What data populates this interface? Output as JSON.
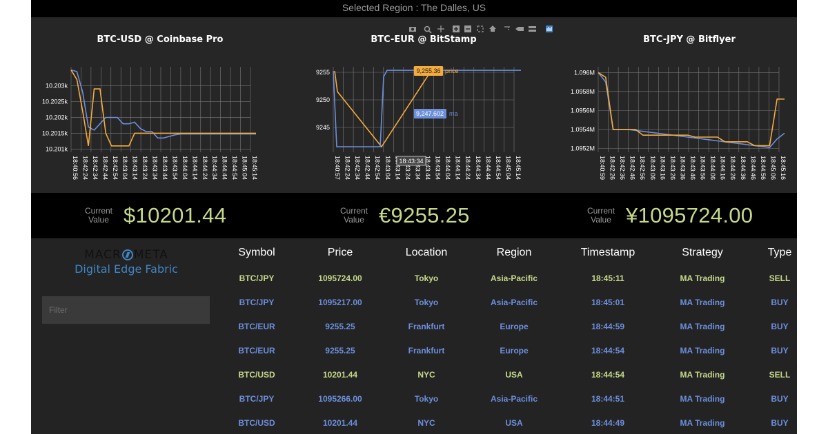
{
  "region_text": "Selected Region : The Dalles, US",
  "colors": {
    "line_blue": "#6c8fdc",
    "line_orange": "#f5ac3d",
    "value_green": "#c5d98a",
    "sell_green": "#c5d98a",
    "buy_blue": "#6c8fdc"
  },
  "toolbar_icons": [
    "camera-icon",
    "zoom-icon",
    "pan-icon",
    "zoom-in-icon",
    "zoom-out-icon",
    "autoscale-icon",
    "home-icon",
    "spike-lines-icon",
    "hover-closest-icon",
    "hover-compare-icon",
    "plotly-logo-icon"
  ],
  "chart_data": [
    {
      "type": "line",
      "title": "BTC-USD @ Coinbase Pro",
      "y_ticks": [
        "10.203k",
        "10.2025k",
        "10.202k",
        "10.2015k",
        "10.201k"
      ],
      "x_ticks": [
        "18:40:56",
        "18:42:24",
        "18:42:34",
        "18:42:44",
        "18:42:54",
        "18:43:04",
        "18:43:14",
        "18:43:24",
        "18:43:34",
        "18:43:44",
        "18:43:54",
        "18:44:04",
        "18:44:14",
        "18:44:24",
        "18:44:34",
        "18:44:44",
        "18:44:54",
        "18:45:04",
        "18:45:14"
      ],
      "ylim": [
        10200.9,
        10203.6
      ],
      "series": [
        {
          "values": [
            10203.5,
            10203.45,
            10202.8,
            10201.7,
            10201.6,
            10201.8,
            10202.0,
            10202.0,
            10202.0,
            10201.8,
            10201.8,
            10201.85,
            10201.65,
            10201.55,
            10201.55,
            10201.35,
            10201.35,
            10201.4,
            10201.45,
            10201.48,
            10201.48,
            10201.48,
            10201.48,
            10201.48,
            10201.48,
            10201.48,
            10201.48,
            10201.48,
            10201.48,
            10201.48,
            10201.48,
            10201.48,
            10201.48
          ]
        },
        {
          "values": [
            10203.5,
            10203.2,
            10202.2,
            10201.1,
            10202.9,
            10202.9,
            10201.5,
            10201.1,
            10201.1,
            10201.1,
            10201.1,
            10201.5,
            10201.5,
            10201.5,
            10201.5,
            10201.5,
            10201.5,
            10201.5,
            10201.5,
            10201.5,
            10201.5,
            10201.5,
            10201.5,
            10201.5,
            10201.5,
            10201.5,
            10201.5,
            10201.5,
            10201.5,
            10201.5,
            10201.5,
            10201.5,
            10201.5
          ]
        }
      ]
    },
    {
      "type": "line",
      "title": "BTC-EUR @ BitStamp",
      "y_ticks": [
        "9255",
        "9250",
        "9245"
      ],
      "x_ticks": [
        "18:40:57",
        "18:42:24",
        "18:42:34",
        "18:42:44",
        "18:42:54",
        "18:43:04",
        "18:43:14",
        "18:43:24",
        "18:43:34",
        "18:43:44",
        "18:43:54",
        "18:44:04",
        "18:44:14",
        "18:44:24",
        "18:44:34",
        "18:44:44",
        "18:44:54",
        "18:45:04",
        "18:45:14"
      ],
      "ylim": [
        9240.5,
        9256
      ],
      "series": [
        {
          "name": "price",
          "values": [
            9255.25,
            9241.5,
            9241.5,
            9241.5,
            9241.5,
            9241.5,
            9241.5,
            9241.5,
            9241.5,
            9254.2,
            9255.36,
            9255.36,
            9255.36,
            9255.36,
            9255.36,
            9255.36,
            9255.36,
            9255.36,
            9255.36,
            9255.36,
            9255.36
          ]
        },
        {
          "name": "ma",
          "values": [
            9255.25,
            9251.5,
            9250.0,
            9248.5,
            9247.0,
            9245.5,
            9244.0,
            9242.5,
            9241.5,
            9243.0,
            9245.0,
            9247.602,
            9249.5,
            9251.5,
            9253.5,
            9255.3
          ]
        }
      ],
      "hover": {
        "price": "9,255.36",
        "ma": "9,247.602",
        "x": "18:43:34"
      }
    },
    {
      "type": "line",
      "title": "BTC-JPY @ Bitflyer",
      "y_ticks": [
        "1.096M",
        "1.0958M",
        "1.0956M",
        "1.0954M",
        "1.0952M"
      ],
      "x_ticks": [
        "18:40:59",
        "18:42:26",
        "18:42:36",
        "18:42:46",
        "18:42:56",
        "18:43:06",
        "18:43:16",
        "18:43:26",
        "18:43:36",
        "18:43:46",
        "18:43:56",
        "18:44:06",
        "18:44:16",
        "18:44:26",
        "18:44:36",
        "18:44:46",
        "18:44:56",
        "18:45:06",
        "18:45:16"
      ],
      "ylim": [
        1095160,
        1096060
      ],
      "series": [
        {
          "values": [
            1096000,
            1095900,
            1095400,
            1095400,
            1095400,
            1095390,
            1095380,
            1095370,
            1095360,
            1095350,
            1095340,
            1095330,
            1095320,
            1095310,
            1095300,
            1095290,
            1095280,
            1095270,
            1095260,
            1095250,
            1095240,
            1095230,
            1095220,
            1095210,
            1095300,
            1095360
          ]
        },
        {
          "values": [
            1096000,
            1095950,
            1095400,
            1095400,
            1095400,
            1095400,
            1095340,
            1095340,
            1095340,
            1095340,
            1095340,
            1095340,
            1095340,
            1095320,
            1095320,
            1095320,
            1095320,
            1095270,
            1095270,
            1095270,
            1095270,
            1095230,
            1095230,
            1095230,
            1095720,
            1095720
          ]
        }
      ]
    }
  ],
  "current_values": [
    {
      "label": "Current Value",
      "value": "$10201.44"
    },
    {
      "label": "Current Value",
      "value": "€9255.25"
    },
    {
      "label": "Current Value",
      "value": "¥1095724.00"
    }
  ],
  "logo": {
    "word": "MACROMETA",
    "subtitle": "Digital Edge Fabric"
  },
  "filter": {
    "placeholder": "Filter",
    "value": ""
  },
  "table": {
    "columns": [
      "Symbol",
      "Price",
      "Location",
      "Region",
      "Timestamp",
      "Strategy",
      "Type"
    ],
    "rows": [
      [
        "BTC/JPY",
        "1095724.00",
        "Tokyo",
        "Asia-Pacific",
        "18:45:11",
        "MA Trading",
        "SELL"
      ],
      [
        "BTC/JPY",
        "1095217.00",
        "Tokyo",
        "Asia-Pacific",
        "18:45:01",
        "MA Trading",
        "BUY"
      ],
      [
        "BTC/EUR",
        "9255.25",
        "Frankfurt",
        "Europe",
        "18:44:59",
        "MA Trading",
        "BUY"
      ],
      [
        "BTC/EUR",
        "9255.25",
        "Frankfurt",
        "Europe",
        "18:44:54",
        "MA Trading",
        "BUY"
      ],
      [
        "BTC/USD",
        "10201.44",
        "NYC",
        "USA",
        "18:44:54",
        "MA Trading",
        "SELL"
      ],
      [
        "BTC/JPY",
        "1095266.00",
        "Tokyo",
        "Asia-Pacific",
        "18:44:51",
        "MA Trading",
        "BUY"
      ],
      [
        "BTC/USD",
        "10201.44",
        "NYC",
        "USA",
        "18:44:49",
        "MA Trading",
        "BUY"
      ]
    ]
  }
}
